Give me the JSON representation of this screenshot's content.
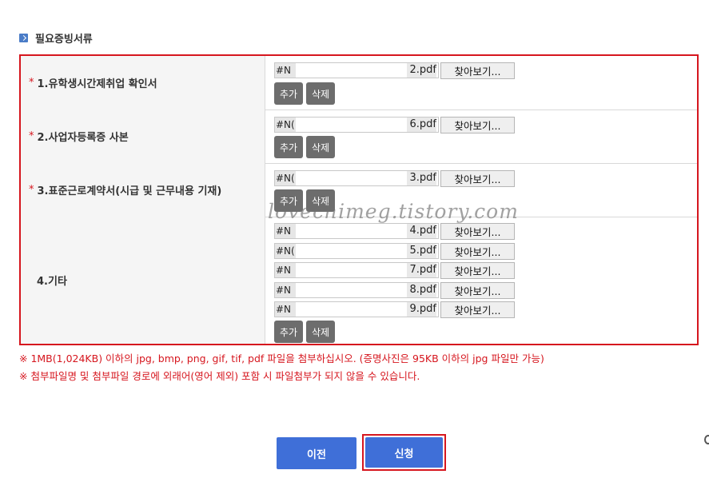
{
  "section": {
    "title": "필요증빙서류",
    "icon": "arrow-right-icon"
  },
  "rows": [
    {
      "required": true,
      "label": "1.유학생시간제취업 확인서",
      "files": [
        {
          "prefix": "#N",
          "suffix": "2.pdf"
        }
      ]
    },
    {
      "required": true,
      "label": "2.사업자등록증 사본",
      "files": [
        {
          "prefix": "#N(",
          "suffix": "6.pdf"
        }
      ]
    },
    {
      "required": true,
      "label": "3.표준근로계약서(시급 및 근무내용 기재)",
      "files": [
        {
          "prefix": "#N(",
          "suffix": "3.pdf"
        }
      ]
    },
    {
      "required": false,
      "label": "4.기타",
      "files": [
        {
          "prefix": "#N",
          "suffix": "4.pdf"
        },
        {
          "prefix": "#N(",
          "suffix": "5.pdf"
        },
        {
          "prefix": "#N",
          "suffix": "7.pdf"
        },
        {
          "prefix": "#N",
          "suffix": "8.pdf"
        },
        {
          "prefix": "#N",
          "suffix": "9.pdf"
        }
      ]
    }
  ],
  "required_mark": "*",
  "browse_label": "찾아보기...",
  "add_label": "추가",
  "delete_label": "삭제",
  "notes": [
    "※ 1MB(1,024KB) 이하의 jpg, bmp, png, gif, tif, pdf 파일을 첨부하십시오. (증명사진은 95KB 이하의 jpg 파일만 가능)",
    "※ 첨부파일명 및 첨부파일 경로에 외래어(영어 제외) 포함 시 파일첨부가 되지 않을 수 있습니다."
  ],
  "buttons": {
    "prev": "이전",
    "apply": "신청"
  },
  "watermark": "lovechimeg.tistory.com",
  "colors": {
    "accent_red": "#d6161e",
    "primary_blue": "#3f6fd8",
    "button_gray": "#6d6d6d"
  }
}
